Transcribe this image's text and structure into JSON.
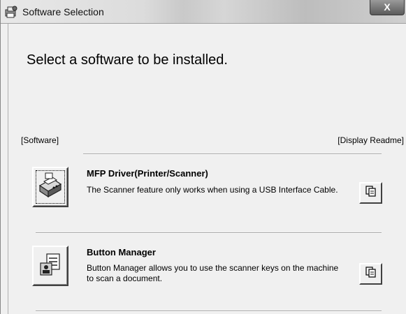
{
  "window": {
    "title": "Software Selection",
    "close_label": "X"
  },
  "main": {
    "heading": "Select a software to be installed.",
    "column_left": "[Software]",
    "column_right": "[Display Readme]",
    "items": [
      {
        "title": "MFP Driver(Printer/Scanner)",
        "description": "The Scanner feature only works when using a USB Interface Cable.",
        "icon": "printer-scanner-icon",
        "readme_icon": "document-copy-icon"
      },
      {
        "title": "Button Manager",
        "description": "Button Manager allows you to use the scanner keys on the machine to scan a document.",
        "icon": "button-manager-icon",
        "readme_icon": "document-copy-icon"
      }
    ]
  }
}
